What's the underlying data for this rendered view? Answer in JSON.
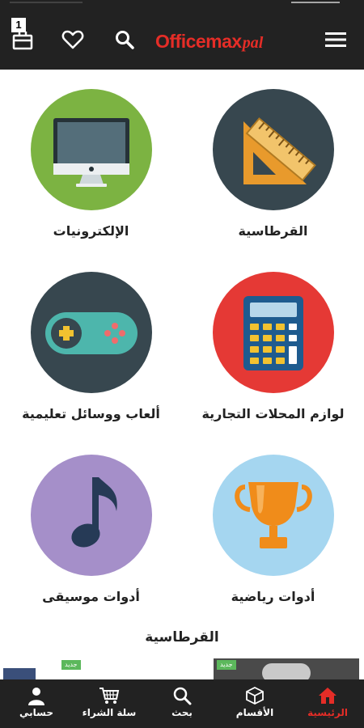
{
  "header": {
    "cart_count": "1",
    "logo_main": "Officemax",
    "logo_suffix": "pal"
  },
  "categories": [
    {
      "label": "القرطاسية",
      "icon": "ruler-triangle-icon",
      "bg": "#37474f"
    },
    {
      "label": "الإلكترونيات",
      "icon": "monitor-icon",
      "bg": "#7cb342"
    },
    {
      "label": "لوازم المحلات التجارية",
      "icon": "calculator-icon",
      "bg": "#e53935"
    },
    {
      "label": "ألعاب ووسائل تعليمية",
      "icon": "gamepad-icon",
      "bg": "#37474f"
    },
    {
      "label": "أدوات رياضية",
      "icon": "trophy-icon",
      "bg": "#a5d6f0"
    },
    {
      "label": "أدوات موسيقى",
      "icon": "music-note-icon",
      "bg": "#a58fc9"
    }
  ],
  "section": {
    "title": "القرطاسية",
    "new_badge": "جديد"
  },
  "nav": {
    "home": "الرئيسية",
    "categories": "الأقسام",
    "search": "بحث",
    "cart": "سلة الشراء",
    "account": "حسابي"
  },
  "colors": {
    "header_bg": "#222222",
    "brand_red": "#e52d27"
  }
}
